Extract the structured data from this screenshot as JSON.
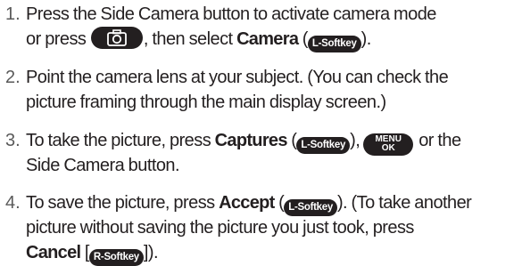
{
  "steps": [
    {
      "number": "1.",
      "line1_a": "Press the Side Camera button to activate camera mode",
      "line2_a": "or press ",
      "line2_b": ", then select ",
      "line2_bold": "Camera",
      "line2_c": " (",
      "line2_softkey": "L-Softkey",
      "line2_d": ")."
    },
    {
      "number": "2.",
      "line1": "Point the camera lens at your subject. (You can check the",
      "line2": "picture framing through the main display screen.)"
    },
    {
      "number": "3.",
      "line1_a": "To take the picture, press ",
      "line1_bold": "Captures",
      "line1_b": " (",
      "line1_softkey": "L-Softkey",
      "line1_c": "),",
      "menu_key_top": "MENU",
      "menu_key_bottom": "OK",
      "line1_d": "or the",
      "line2": "Side Camera button."
    },
    {
      "number": "4.",
      "line1_a": "To save the picture, press ",
      "line1_bold": "Accept",
      "line1_b": " (",
      "line1_softkey": "L-Softkey",
      "line1_c": "). (To take another",
      "line2": "picture without saving the picture you just took, press",
      "line3_bold": "Cancel",
      "line3_a": " [",
      "line3_softkey": "R-Softkey",
      "line3_b": "])."
    }
  ],
  "icons": {
    "camera_key": "camera-icon",
    "menu_key": "menu-ok-key-icon",
    "softkey": "softkey-badge"
  },
  "colors": {
    "text": "#231f20",
    "number": "#5a5a5a",
    "key_fill": "#231f20"
  }
}
